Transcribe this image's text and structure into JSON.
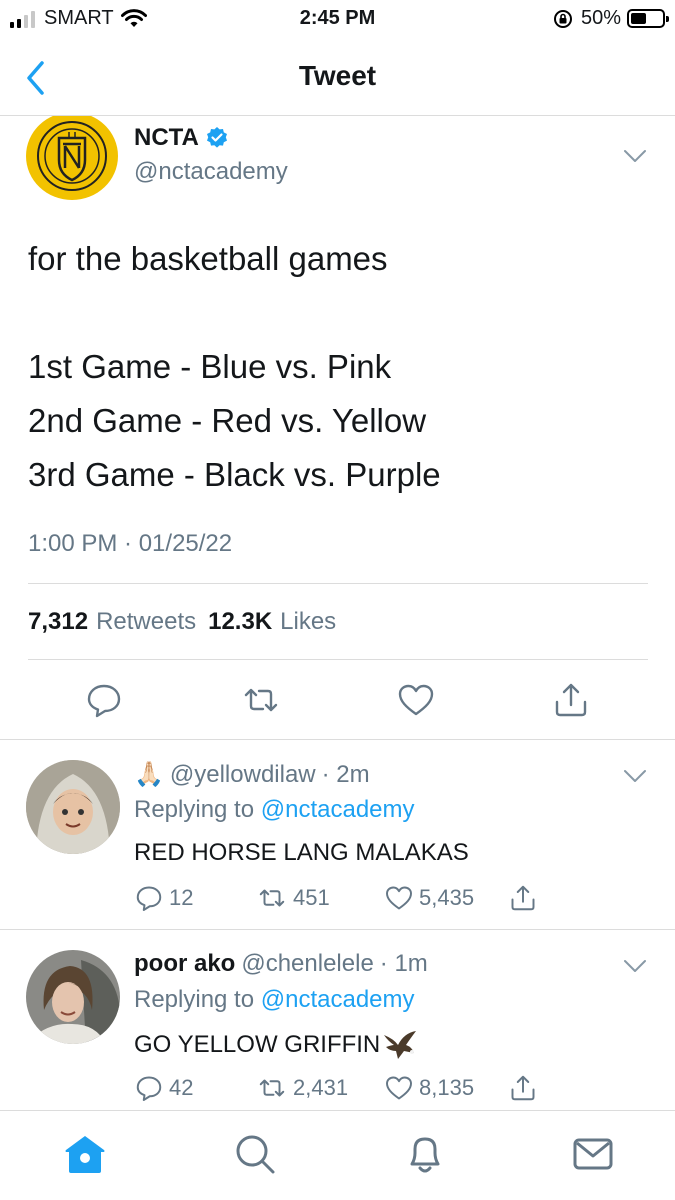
{
  "status_bar": {
    "carrier": "SMART",
    "time": "2:45 PM",
    "battery": "50%",
    "battery_level": 0.5,
    "signal_bars_active": 2
  },
  "nav": {
    "title": "Tweet",
    "back_icon": "chevron-left-icon"
  },
  "tweet": {
    "author_name": "NCTA",
    "author_handle": "@nctacademy",
    "verified": true,
    "text_lines": [
      "for the basketball games",
      "",
      "1st Game - Blue vs. Pink",
      "2nd Game - Red vs. Yellow",
      "3rd Game - Black vs. Purple"
    ],
    "timestamp": "1:00 PM · 01/25/22",
    "retweets_count": "7,312",
    "retweets_label": "Retweets",
    "likes_count": "12.3K",
    "likes_label": "Likes"
  },
  "replies": [
    {
      "display_name": "",
      "name_emoji": "🙏🏻",
      "handle": "@yellowdilaw",
      "age": "· 2m",
      "replying_label": "Replying to",
      "replying_to": "@nctacademy",
      "text": "RED HORSE LANG MALAKAS",
      "replies": "12",
      "retweets": "451",
      "likes": "5,435"
    },
    {
      "display_name": "poor ako",
      "handle": "@chenlelele",
      "age": "· 1m",
      "replying_label": "Replying to",
      "replying_to": "@nctacademy",
      "text": "GO YELLOW GRIFFIN",
      "replies": "42",
      "retweets": "2,431",
      "likes": "8,135"
    }
  ],
  "colors": {
    "accent": "#1da1f2",
    "secondary_text": "#657786",
    "primary_text": "#14171a",
    "divider": "#dcdcdc",
    "logo_gold": "#f2c200"
  },
  "tabs": [
    "home-icon",
    "search-icon",
    "notifications-bell-icon",
    "messages-envelope-icon"
  ]
}
